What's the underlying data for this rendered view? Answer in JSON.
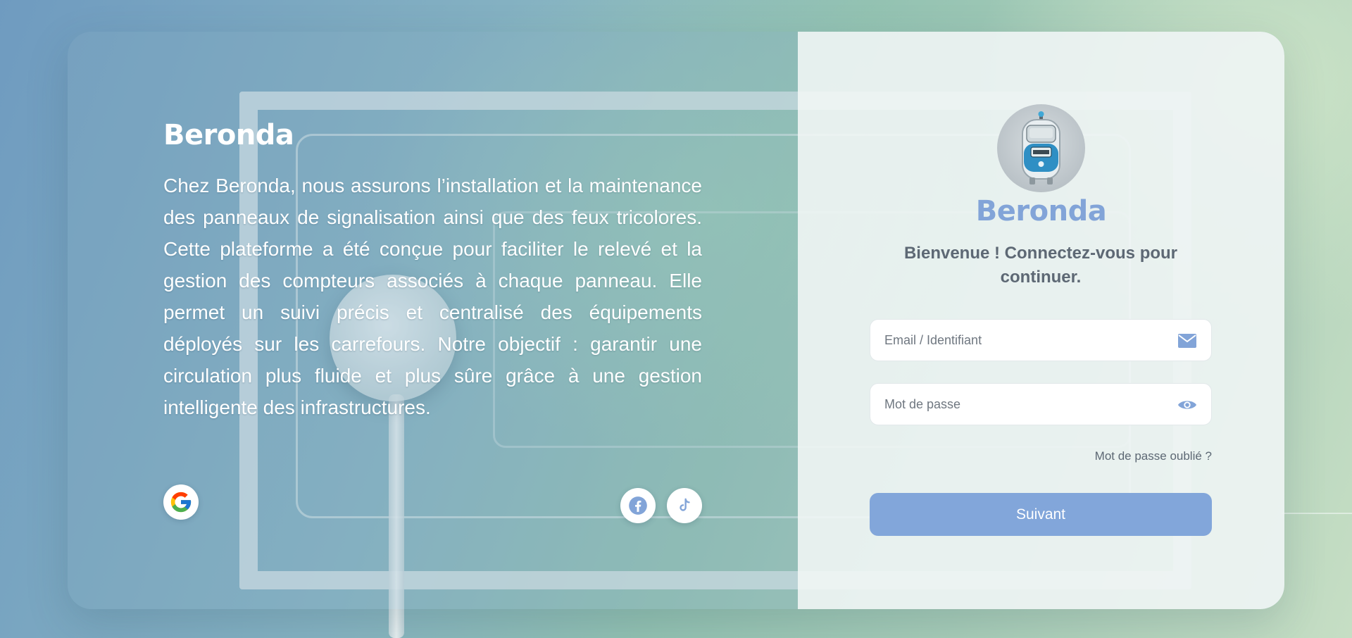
{
  "brand": {
    "name": "Beronda",
    "accent_color": "#82a4d8"
  },
  "left_panel": {
    "title": "Beronda",
    "description": "Chez Beronda, nous assurons l’installation et la maintenance des panneaux de signalisation ainsi que des feux tricolores. Cette plateforme a été conçue pour faciliter le relevé et la gestion des compteurs associés à chaque panneau. Elle permet un suivi précis et centralisé des équipements déployés sur les carrefours. Notre objectif : garantir une circulation plus fluide et plus sûre grâce à une gestion intelligente des infrastructures.",
    "social": [
      {
        "name": "google",
        "icon": "google-icon"
      },
      {
        "name": "facebook",
        "icon": "facebook-icon"
      },
      {
        "name": "tiktok",
        "icon": "tiktok-icon"
      }
    ]
  },
  "login": {
    "avatar_icon": "meter-robot-icon",
    "title": "Beronda",
    "welcome": "Bienvenue ! Connectez-vous pour continuer.",
    "email": {
      "placeholder": "Email / Identifiant",
      "value": "",
      "icon": "envelope-icon"
    },
    "password": {
      "placeholder": "Mot de passe",
      "value": "",
      "icon": "eye-icon"
    },
    "forgot_label": "Mot de passe oublié ?",
    "submit_label": "Suivant",
    "submit_color": "#82a6da"
  }
}
